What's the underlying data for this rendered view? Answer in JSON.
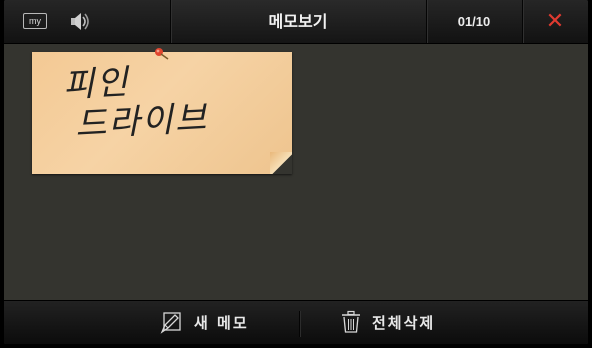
{
  "topbar": {
    "my_icon_label": "my",
    "title": "메모보기",
    "page": "01/10",
    "close_glyph": "✕",
    "speaker_icon": "speaker-icon"
  },
  "memo": {
    "line1": "피인",
    "line2": "드라이브",
    "pin_icon": "pushpin-icon",
    "color": "#f4cc98"
  },
  "bottombar": {
    "new_label": "새 메모",
    "delete_all_label": "전체삭제",
    "new_icon": "pencil-icon",
    "delete_icon": "trash-icon"
  },
  "colors": {
    "close": "#e03a30",
    "background": "#34342f"
  }
}
